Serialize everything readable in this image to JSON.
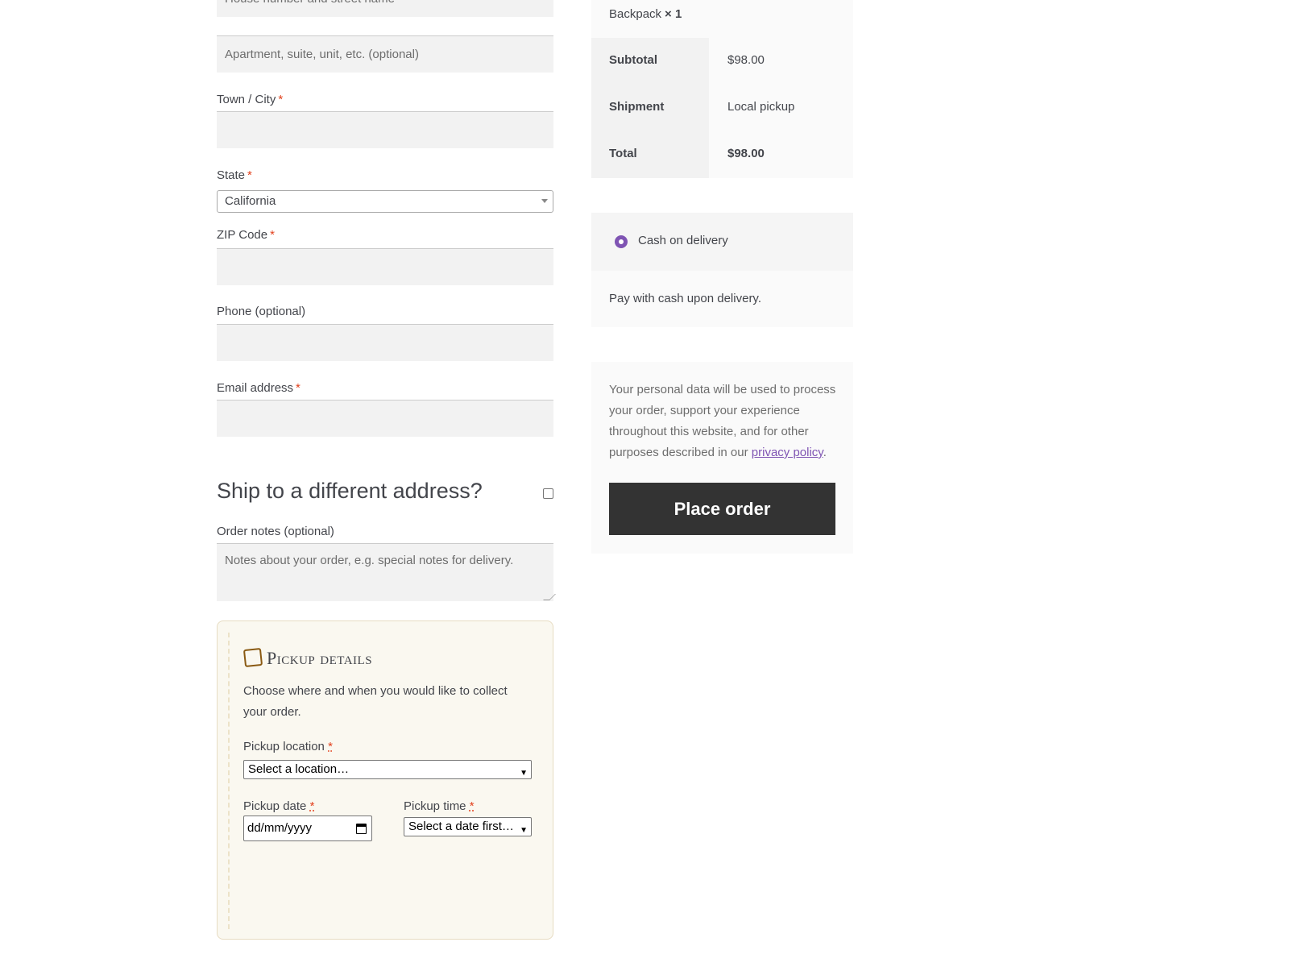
{
  "billing": {
    "street_placeholder": "House number and street name",
    "apartment_placeholder": "Apartment, suite, unit, etc. (optional)",
    "city_label": "Town / City",
    "state_label": "State",
    "state_value": "California",
    "zip_label": "ZIP Code",
    "phone_label": "Phone (optional)",
    "email_label": "Email address",
    "required_mark": "*"
  },
  "shipping": {
    "different_address_label": "Ship to a different address?"
  },
  "order_notes": {
    "label": "Order notes (optional)",
    "placeholder": "Notes about your order, e.g. special notes for delivery."
  },
  "pickup": {
    "title": "Pickup details",
    "description": "Choose where and when you would like to collect your order.",
    "location_label": "Pickup location",
    "location_value": "Select a location…",
    "date_label": "Pickup date",
    "date_value": "dd/mm/yyyy",
    "time_label": "Pickup time",
    "time_value": "Select a date first…",
    "required_mark": "*"
  },
  "summary": {
    "product_name": "Backpack",
    "product_qty": "× 1",
    "rows": [
      {
        "label": "Subtotal",
        "value": "$98.00"
      },
      {
        "label": "Shipment",
        "value": "Local pickup"
      },
      {
        "label": "Total",
        "value": "$98.00"
      }
    ]
  },
  "payment": {
    "method_label": "Cash on delivery",
    "method_description": "Pay with cash upon delivery."
  },
  "terms": {
    "text_before": "Your personal data will be used to process your order, support your experience throughout this website, and for other purposes described in our ",
    "link_text": "privacy policy",
    "text_after": "."
  },
  "place_order_label": "Place order",
  "colors": {
    "accent": "#7f54b3",
    "button": "#333333",
    "required": "#e2401c",
    "pickup_bg": "#faf8f0"
  }
}
